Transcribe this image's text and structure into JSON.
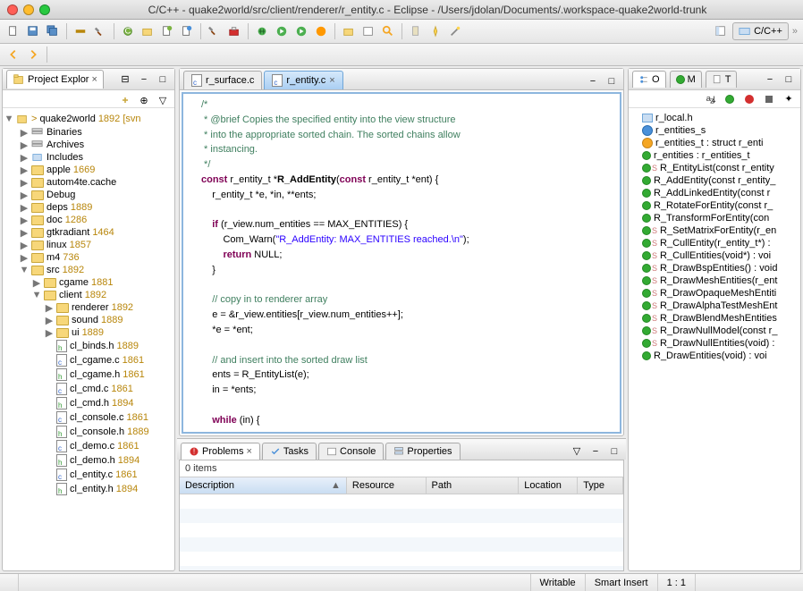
{
  "window": {
    "title": "C/C++ - quake2world/src/client/renderer/r_entity.c - Eclipse - /Users/jdolan/Documents/.workspace-quake2world-trunk"
  },
  "perspective": {
    "label": "C/C++"
  },
  "project_explorer": {
    "title": "Project Explor",
    "root": {
      "name": "quake2world",
      "rev": "1892",
      "suffix": "[svn"
    },
    "items": [
      {
        "indent": 1,
        "type": "bin",
        "name": "Binaries"
      },
      {
        "indent": 1,
        "type": "bin",
        "name": "Archives"
      },
      {
        "indent": 1,
        "type": "inc",
        "name": "Includes"
      },
      {
        "indent": 1,
        "type": "folder",
        "name": "apple",
        "rev": "1669"
      },
      {
        "indent": 1,
        "type": "folder",
        "name": "autom4te.cache"
      },
      {
        "indent": 1,
        "type": "folder",
        "name": "Debug"
      },
      {
        "indent": 1,
        "type": "folder",
        "name": "deps",
        "rev": "1889"
      },
      {
        "indent": 1,
        "type": "folder",
        "name": "doc",
        "rev": "1286"
      },
      {
        "indent": 1,
        "type": "folder",
        "name": "gtkradiant",
        "rev": "1464"
      },
      {
        "indent": 1,
        "type": "folder",
        "name": "linux",
        "rev": "1857"
      },
      {
        "indent": 1,
        "type": "folder",
        "name": "m4",
        "rev": "736"
      },
      {
        "indent": 1,
        "type": "folder-open",
        "name": "src",
        "rev": "1892"
      },
      {
        "indent": 2,
        "type": "folder",
        "name": "cgame",
        "rev": "1881"
      },
      {
        "indent": 2,
        "type": "folder-open",
        "name": "client",
        "rev": "1892"
      },
      {
        "indent": 3,
        "type": "folder",
        "name": "renderer",
        "rev": "1892"
      },
      {
        "indent": 3,
        "type": "folder",
        "name": "sound",
        "rev": "1889"
      },
      {
        "indent": 3,
        "type": "folder",
        "name": "ui",
        "rev": "1889"
      },
      {
        "indent": 3,
        "type": "file-h",
        "name": "cl_binds.h",
        "rev": "1889"
      },
      {
        "indent": 3,
        "type": "file-c",
        "name": "cl_cgame.c",
        "rev": "1861"
      },
      {
        "indent": 3,
        "type": "file-h",
        "name": "cl_cgame.h",
        "rev": "1861"
      },
      {
        "indent": 3,
        "type": "file-c",
        "name": "cl_cmd.c",
        "rev": "1861"
      },
      {
        "indent": 3,
        "type": "file-h",
        "name": "cl_cmd.h",
        "rev": "1894"
      },
      {
        "indent": 3,
        "type": "file-c",
        "name": "cl_console.c",
        "rev": "1861"
      },
      {
        "indent": 3,
        "type": "file-h",
        "name": "cl_console.h",
        "rev": "1889"
      },
      {
        "indent": 3,
        "type": "file-c",
        "name": "cl_demo.c",
        "rev": "1861"
      },
      {
        "indent": 3,
        "type": "file-h",
        "name": "cl_demo.h",
        "rev": "1894"
      },
      {
        "indent": 3,
        "type": "file-c",
        "name": "cl_entity.c",
        "rev": "1861"
      },
      {
        "indent": 3,
        "type": "file-h",
        "name": "cl_entity.h",
        "rev": "1894"
      }
    ]
  },
  "editor": {
    "tabs": [
      {
        "label": "r_surface.c",
        "active": false
      },
      {
        "label": "r_entity.c",
        "active": true
      }
    ],
    "code": {
      "l1": "/*",
      "l2": " * @brief Copies the specified entity into the view structure",
      "l3": " * into the appropriate sorted chain. The sorted chains allow",
      "l4": " * instancing.",
      "l5": " */",
      "l6a": "const",
      "l6b": " r_entity_t *",
      "l6c": "R_AddEntity",
      "l6d": "(",
      "l6e": "const",
      "l6f": " r_entity_t *ent) {",
      "l7": "    r_entity_t *e, *in, **ents;",
      "l8": "",
      "l9a": "    ",
      "l9b": "if",
      "l9c": " (r_view.num_entities == MAX_ENTITIES) {",
      "l10a": "        Com_Warn(",
      "l10b": "\"R_AddEntity: MAX_ENTITIES reached.\\n\"",
      "l10c": ");",
      "l11a": "        ",
      "l11b": "return",
      "l11c": " NULL;",
      "l12": "    }",
      "l13": "",
      "l14": "    // copy in to renderer array",
      "l15": "    e = &r_view.entities[r_view.num_entities++];",
      "l16": "    *e = *ent;",
      "l17": "",
      "l18": "    // and insert into the sorted draw list",
      "l19": "    ents = R_EntityList(e);",
      "l20": "    in = *ents;",
      "l21": "",
      "l22a": "    ",
      "l22b": "while",
      "l22c": " (in) {"
    }
  },
  "outline": {
    "tabs": [
      "O",
      "M",
      "T"
    ],
    "items": [
      {
        "icon": "inc",
        "label": "r_local.h"
      },
      {
        "icon": "struct",
        "label": "r_entities_s"
      },
      {
        "icon": "type",
        "label": "r_entities_t : struct r_enti"
      },
      {
        "icon": "var",
        "label": "r_entities : r_entities_t"
      },
      {
        "icon": "func-s",
        "label": "R_EntityList(const r_entity"
      },
      {
        "icon": "func",
        "label": "R_AddEntity(const r_entity_"
      },
      {
        "icon": "func",
        "label": "R_AddLinkedEntity(const r"
      },
      {
        "icon": "func",
        "label": "R_RotateForEntity(const r_"
      },
      {
        "icon": "func",
        "label": "R_TransformForEntity(con"
      },
      {
        "icon": "func-s",
        "label": "R_SetMatrixForEntity(r_en"
      },
      {
        "icon": "func-s",
        "label": "R_CullEntity(r_entity_t*) : "
      },
      {
        "icon": "func-s",
        "label": "R_CullEntities(void*) : voi"
      },
      {
        "icon": "func-s",
        "label": "R_DrawBspEntities() : void"
      },
      {
        "icon": "func-s",
        "label": "R_DrawMeshEntities(r_ent"
      },
      {
        "icon": "func-s",
        "label": "R_DrawOpaqueMeshEntiti"
      },
      {
        "icon": "func-s",
        "label": "R_DrawAlphaTestMeshEnt"
      },
      {
        "icon": "func-s",
        "label": "R_DrawBlendMeshEntities"
      },
      {
        "icon": "func-s",
        "label": "R_DrawNullModel(const r_"
      },
      {
        "icon": "func-s",
        "label": "R_DrawNullEntities(void) : "
      },
      {
        "icon": "func",
        "label": "R_DrawEntities(void) : voi"
      }
    ]
  },
  "problems": {
    "tabs": [
      "Problems",
      "Tasks",
      "Console",
      "Properties"
    ],
    "count_text": "0 items",
    "columns": {
      "desc": "Description",
      "res": "Resource",
      "path": "Path",
      "loc": "Location",
      "type": "Type"
    }
  },
  "status": {
    "mode": "Writable",
    "insert": "Smart Insert",
    "pos": "1 : 1"
  }
}
